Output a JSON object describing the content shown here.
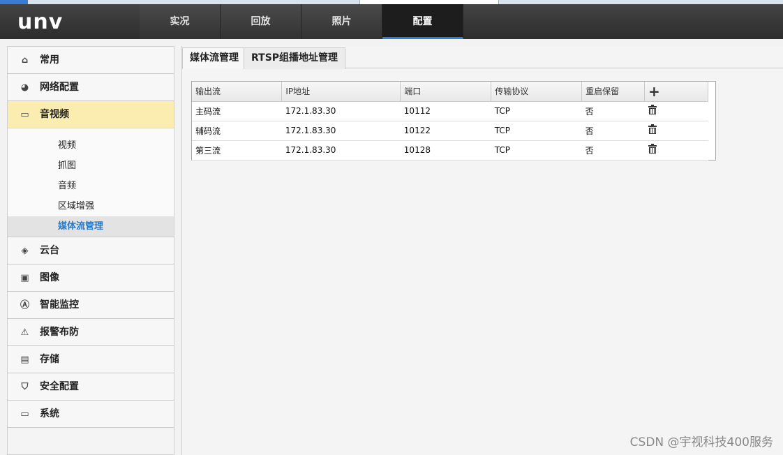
{
  "header": {
    "logo": "unv",
    "nav": [
      "实况",
      "回放",
      "照片",
      "配置"
    ],
    "active_nav": "配置"
  },
  "sidebar": {
    "items": [
      {
        "label": "常用",
        "icon": "home-icon"
      },
      {
        "label": "网络配置",
        "icon": "network-globe-icon"
      },
      {
        "label": "音视频",
        "icon": "video-icon"
      },
      {
        "label": "云台",
        "icon": "ptz-icon"
      },
      {
        "label": "图像",
        "icon": "image-icon"
      },
      {
        "label": "智能监控",
        "icon": "smart-icon"
      },
      {
        "label": "报警布防",
        "icon": "warning-icon"
      },
      {
        "label": "存储",
        "icon": "storage-icon"
      },
      {
        "label": "安全配置",
        "icon": "shield-icon"
      },
      {
        "label": "系统",
        "icon": "system-icon"
      }
    ],
    "sub_items": [
      "视频",
      "抓图",
      "音频",
      "区域增强",
      "媒体流管理"
    ],
    "active_sub": "媒体流管理"
  },
  "tabs": [
    "媒体流管理",
    "RTSP组播地址管理"
  ],
  "table": {
    "headers": [
      "输出流",
      "IP地址",
      "端口",
      "传输协议",
      "重启保留"
    ],
    "rows": [
      [
        "主码流",
        "172.1.83.30",
        "10112",
        "TCP",
        "否"
      ],
      [
        "辅码流",
        "172.1.83.30",
        "10122",
        "TCP",
        "否"
      ],
      [
        "第三流",
        "172.1.83.30",
        "10128",
        "TCP",
        "否"
      ]
    ]
  },
  "watermark": "CSDN @宇视科技400服务"
}
